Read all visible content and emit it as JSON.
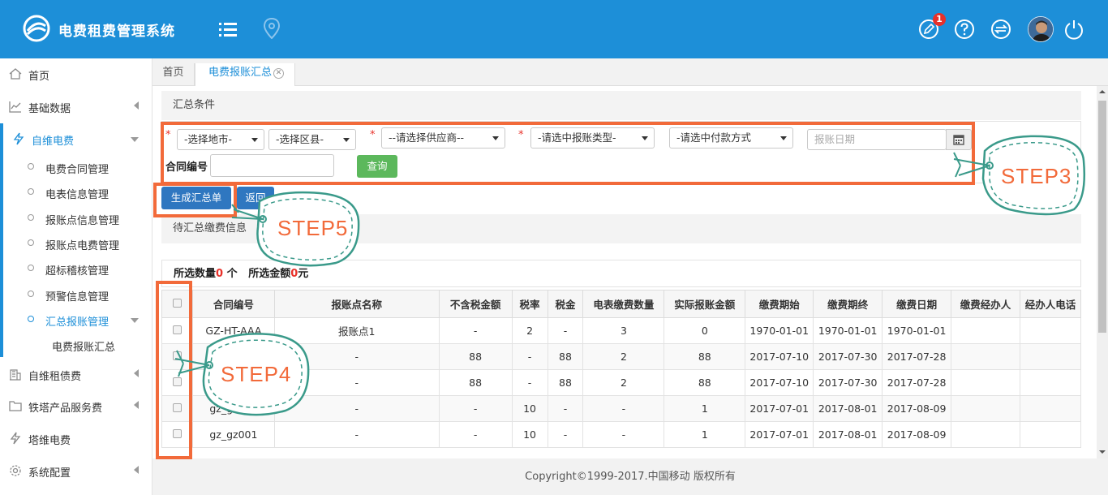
{
  "header": {
    "app_title": "电费租费管理系统",
    "notification_count": "1",
    "colors": {
      "bar": "#1d8fd8"
    }
  },
  "sidebar": {
    "items": [
      {
        "label": "首页",
        "icon": "home-icon"
      },
      {
        "label": "基础数据",
        "icon": "chart-icon"
      },
      {
        "label": "自维电费",
        "icon": "bolt-icon"
      },
      {
        "label": "自维租债费",
        "icon": "building-icon"
      },
      {
        "label": "铁塔产品服务费",
        "icon": "folder-icon"
      },
      {
        "label": "塔维电费",
        "icon": "bolt-icon"
      },
      {
        "label": "系统配置",
        "icon": "gear-icon"
      }
    ],
    "sub_items": [
      {
        "label": "电费合同管理"
      },
      {
        "label": "电表信息管理"
      },
      {
        "label": "报账点信息管理"
      },
      {
        "label": "报账点电费管理"
      },
      {
        "label": "超标稽核管理"
      },
      {
        "label": "预警信息管理"
      },
      {
        "label": "汇总报账管理"
      }
    ],
    "leaf_item": "电费报账汇总"
  },
  "tabs": {
    "home": "首页",
    "current": "电费报账汇总"
  },
  "filters": {
    "section_title": "汇总条件",
    "required_mark": "*",
    "city": "-选择地市-",
    "district": "-选择区县-",
    "supplier": "--请选择供应商--",
    "report_type": "-请选中报账类型-",
    "payment": "-请选中付款方式",
    "date_placeholder": "报账日期",
    "contract_label": "合同编号",
    "query_button": "查询"
  },
  "actions": {
    "generate": "生成汇总单",
    "back": "返回"
  },
  "pending": {
    "title": "待汇总缴费信息",
    "count_label": "所选数量",
    "count_value": "0",
    "count_unit": "个",
    "amount_label": "所选金额",
    "amount_value": "0",
    "amount_unit": "元"
  },
  "table": {
    "columns": [
      "合同编号",
      "报账点名称",
      "不含税金额",
      "税率",
      "税金",
      "电表缴费数量",
      "实际报账金额",
      "缴费期始",
      "缴费期终",
      "缴费日期",
      "缴费经办人",
      "经办人电话"
    ],
    "rows": [
      [
        "GZ-HT-AAA",
        "报账点1",
        "-",
        "2",
        "-",
        "3",
        "0",
        "1970-01-01",
        "1970-01-01",
        "1970-01-01",
        "",
        ""
      ],
      [
        "",
        "-",
        "88",
        "-",
        "88",
        "2",
        "88",
        "2017-07-10",
        "2017-07-30",
        "2017-07-28",
        "",
        ""
      ],
      [
        "",
        "-",
        "88",
        "-",
        "88",
        "2",
        "88",
        "2017-07-10",
        "2017-07-30",
        "2017-07-28",
        "",
        ""
      ],
      [
        "gz_gz001",
        "-",
        "-",
        "10",
        "-",
        "-",
        "1",
        "2017-07-01",
        "2017-08-01",
        "2017-08-09",
        "",
        ""
      ],
      [
        "gz_gz001",
        "-",
        "-",
        "10",
        "-",
        "-",
        "1",
        "2017-07-01",
        "2017-08-01",
        "2017-08-09",
        "",
        ""
      ]
    ]
  },
  "footer": {
    "copyright": "Copyright©1999-2017.中国移动 版权所有"
  },
  "annotations": {
    "step3": "STEP3",
    "step4": "STEP4",
    "step5": "STEP5",
    "highlight_color": "#f26a3a",
    "tag_color": "#3a9a8a"
  }
}
